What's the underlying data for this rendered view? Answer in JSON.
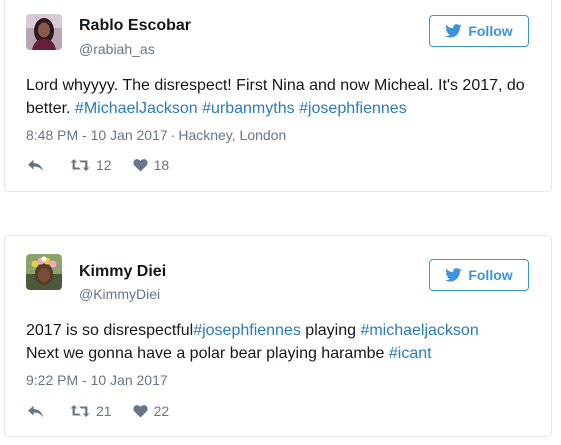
{
  "colors": {
    "link": "#2b7bb9",
    "follow_accent": "#3b94d9",
    "meta_gray": "#657786",
    "text": "#14171a",
    "border": "#e1e8ed"
  },
  "follow_icon": "twitter-bird-icon",
  "tweets": [
    {
      "name": "Rablo Escobar",
      "handle": "@rabiah_as",
      "follow_label": "Follow",
      "text_plain": "Lord whyyyy. The disrespect! First Nina and now Micheal. It's 2017, do better. ",
      "hashtags": [
        "#MichaelJackson",
        "#urbanmyths",
        "#josephfiennes"
      ],
      "timestamp": "8:48 PM - 10 Jan 2017",
      "separator": "·",
      "location": "Hackney, London",
      "retweets": "12",
      "likes": "18"
    },
    {
      "name": "Kimmy Diei",
      "handle": "@KimmyDiei",
      "follow_label": "Follow",
      "text_part1": "2017 is so disrespectful",
      "tag1": "#josephfiennes",
      "text_part2": " playing ",
      "tag2": "#michaeljackson",
      "text_part3": "Next we gonna have a polar bear playing harambe ",
      "tag3": "#icant",
      "timestamp": "9:22 PM - 10 Jan 2017",
      "retweets": "21",
      "likes": "22"
    }
  ]
}
